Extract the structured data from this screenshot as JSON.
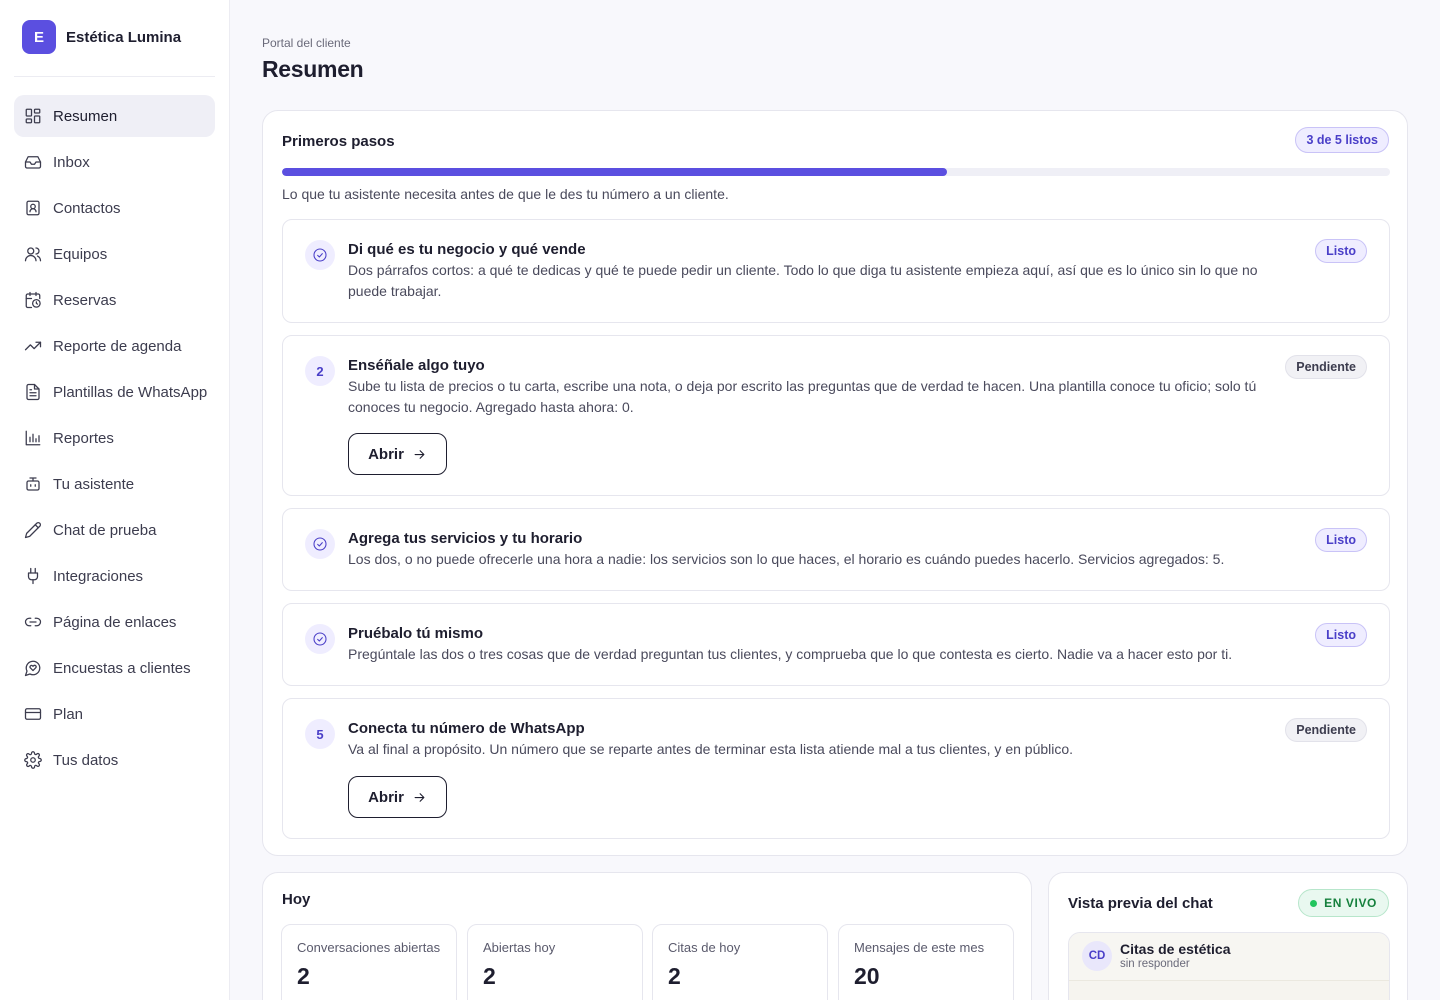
{
  "brand": {
    "initial": "E",
    "name": "Estética Lumina"
  },
  "sidebar": {
    "items": [
      {
        "label": "Resumen",
        "icon": "dashboard-icon",
        "active": true
      },
      {
        "label": "Inbox",
        "icon": "inbox-icon"
      },
      {
        "label": "Contactos",
        "icon": "contacts-icon"
      },
      {
        "label": "Equipos",
        "icon": "users-icon"
      },
      {
        "label": "Reservas",
        "icon": "calendar-clock-icon"
      },
      {
        "label": "Reporte de agenda",
        "icon": "trending-up-icon"
      },
      {
        "label": "Plantillas de WhatsApp",
        "icon": "file-text-icon"
      },
      {
        "label": "Reportes",
        "icon": "bar-chart-icon"
      },
      {
        "label": "Tu asistente",
        "icon": "bot-icon"
      },
      {
        "label": "Chat de prueba",
        "icon": "pencil-icon"
      },
      {
        "label": "Integraciones",
        "icon": "plug-icon"
      },
      {
        "label": "Página de enlaces",
        "icon": "link-icon"
      },
      {
        "label": "Encuestas a clientes",
        "icon": "message-heart-icon"
      },
      {
        "label": "Plan",
        "icon": "credit-card-icon"
      },
      {
        "label": "Tus datos",
        "icon": "gear-icon"
      }
    ]
  },
  "header": {
    "breadcrumb": "Portal del cliente",
    "title": "Resumen"
  },
  "steps_card": {
    "title": "Primeros pasos",
    "count_badge": "3 de 5 listos",
    "progress": 0.6,
    "description": "Lo que tu asistente necesita antes de que le des tu número a un cliente.",
    "steps": [
      {
        "marker": "check-circle-icon",
        "title": "Di qué es tu negocio y qué vende",
        "text": "Dos párrafos cortos: a qué te dedicas y qué te puede pedir un cliente. Todo lo que diga tu asistente empieza aquí, así que es lo único sin lo que no puede trabajar.",
        "status": "Listo"
      },
      {
        "marker": "2",
        "title": "Enséñale algo tuyo",
        "text": "Sube tu lista de precios o tu carta, escribe una nota, o deja por escrito las preguntas que de verdad te hacen. Una plantilla conoce tu oficio; solo tú conoces tu negocio. Agregado hasta ahora: 0.",
        "status": "Pendiente",
        "button": "Abrir"
      },
      {
        "marker": "check-circle-icon",
        "title": "Agrega tus servicios y tu horario",
        "text": "Los dos, o no puede ofrecerle una hora a nadie: los servicios son lo que haces, el horario es cuándo puedes hacerlo. Servicios agregados: 5.",
        "status": "Listo"
      },
      {
        "marker": "check-circle-icon",
        "title": "Pruébalo tú mismo",
        "text": "Pregúntale las dos o tres cosas que de verdad preguntan tus clientes, y comprueba que lo que contesta es cierto. Nadie va a hacer esto por ti.",
        "status": "Listo"
      },
      {
        "marker": "5",
        "title": "Conecta tu número de WhatsApp",
        "text": "Va al final a propósito. Un número que se reparte antes de terminar esta lista atiende mal a tus clientes, y en público.",
        "status": "Pendiente",
        "button": "Abrir"
      }
    ]
  },
  "today": {
    "title": "Hoy",
    "stats": [
      {
        "label": "Conversaciones abiertas",
        "value": "2"
      },
      {
        "label": "Abiertas hoy",
        "value": "2"
      },
      {
        "label": "Citas de hoy",
        "value": "2"
      },
      {
        "label": "Mensajes de este mes",
        "value": "20"
      }
    ]
  },
  "chat_preview": {
    "title": "Vista previa del chat",
    "live_badge": "EN VIVO",
    "contact_initials": "CD",
    "contact_name": "Citas de estética",
    "contact_status": "sin responder"
  },
  "colors": {
    "accent": "#5b4fe0",
    "live": "#22c55e"
  }
}
